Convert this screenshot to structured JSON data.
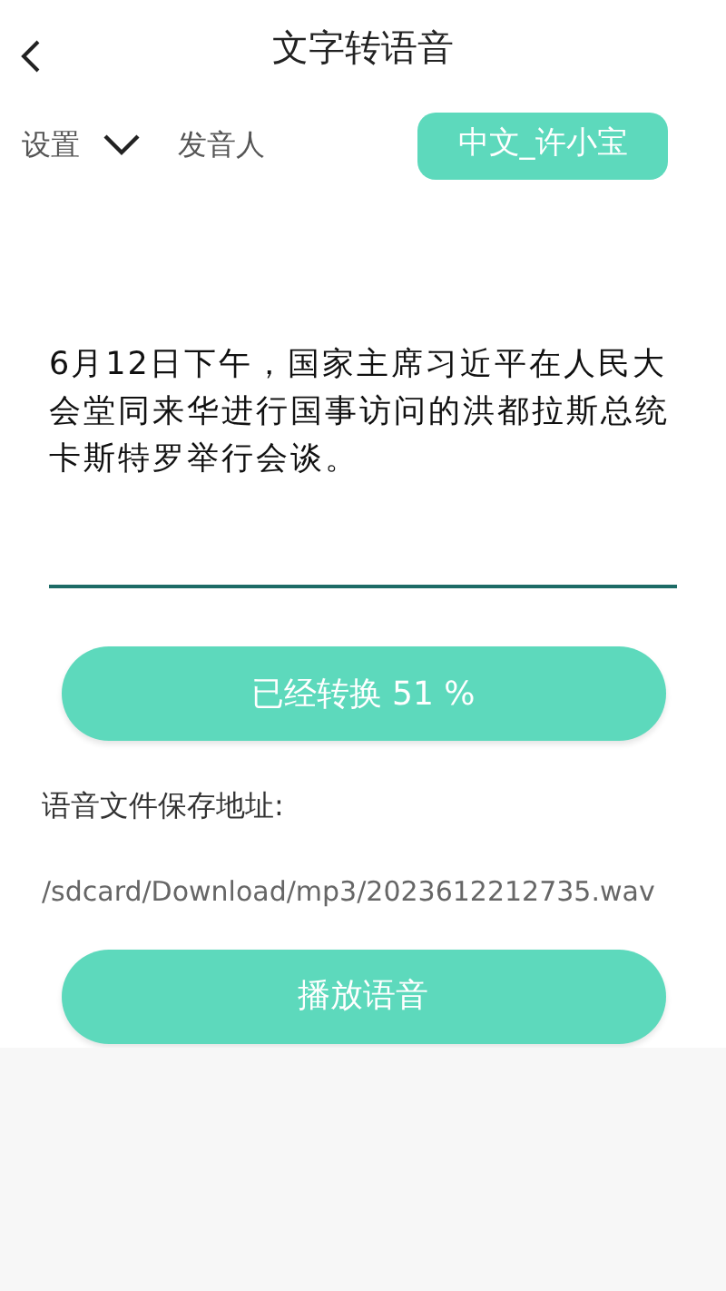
{
  "header": {
    "title": "文字转语音"
  },
  "settings": {
    "label": "设置",
    "speaker_label": "发音人",
    "speaker": "中文_许小宝"
  },
  "text_input": {
    "value": "6月12日下午，国家主席习近平在人民大会堂同来华进行国事访问的洪都拉斯总统卡斯特罗举行会谈。"
  },
  "progress_button": {
    "label": "已经转换 51 %"
  },
  "save_path": {
    "label": "语音文件保存地址:",
    "path": "/sdcard/Download/mp3/2023612212735.wav"
  },
  "play_button": {
    "label": "播放语音"
  }
}
